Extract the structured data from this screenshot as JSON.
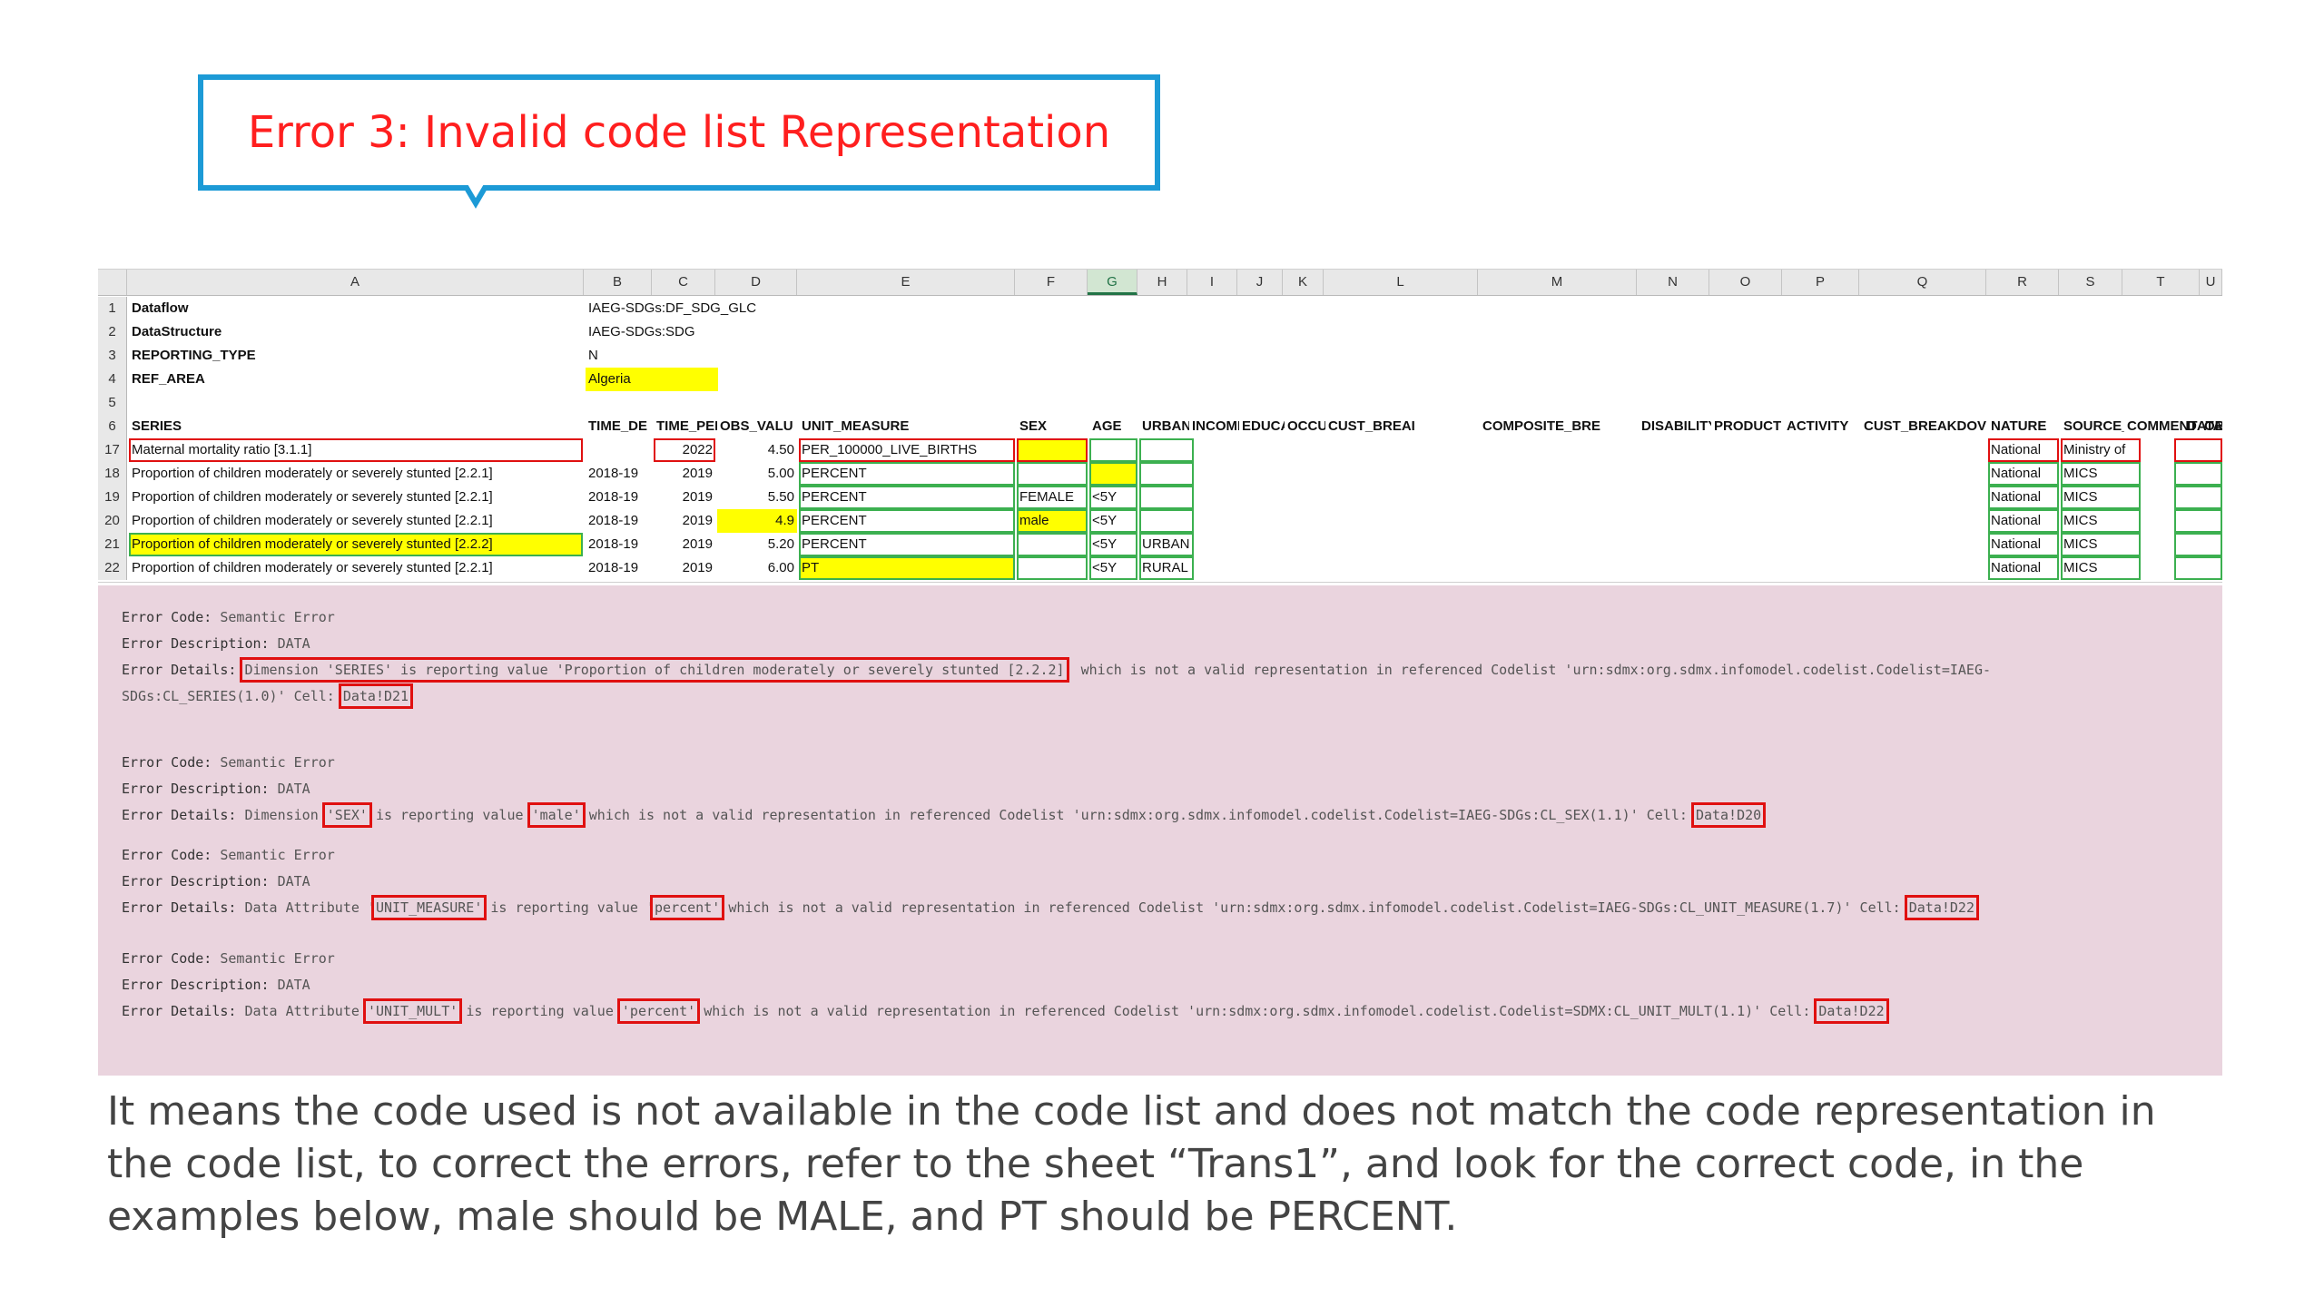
{
  "callout": {
    "title": "Error 3: Invalid code list Representation"
  },
  "sheet": {
    "columns": [
      "A",
      "B",
      "C",
      "D",
      "E",
      "F",
      "G",
      "H",
      "I",
      "J",
      "K",
      "L",
      "M",
      "N",
      "O",
      "P",
      "Q",
      "R",
      "S",
      "T",
      "U"
    ],
    "row_numbers": [
      "1",
      "2",
      "3",
      "4",
      "5",
      "6",
      "17",
      "18",
      "19",
      "20",
      "21",
      "22"
    ],
    "meta": [
      {
        "key": "Dataflow",
        "value": "IAEG-SDGs:DF_SDG_GLC"
      },
      {
        "key": "DataStructure",
        "value": "IAEG-SDGs:SDG"
      },
      {
        "key": "REPORTING_TYPE",
        "value": "N"
      },
      {
        "key": "REF_AREA",
        "value": "Algeria"
      }
    ],
    "headers": [
      "SERIES",
      "TIME_DE",
      "TIME_PEI",
      "OBS_VALU",
      "UNIT_MEASURE",
      "SEX",
      "AGE",
      "URBANI",
      "INCOME",
      "EDUCA",
      "OCCUP",
      "CUST_BREAI",
      "COMPOSITE_BRE",
      "DISABILITY",
      "PRODUCT",
      "ACTIVITY",
      "CUST_BREAKDOV",
      "NATURE",
      "SOURCE_DI",
      "COMMENT",
      "OBS_STA",
      "DATA_"
    ],
    "rows": [
      {
        "series": "Maternal mortality ratio [3.1.1]",
        "time_detail": "",
        "time_period": "2022",
        "obs": "4.50",
        "unit": "PER_100000_LIVE_BIRTHS",
        "sex": "",
        "age": "",
        "urban": "",
        "nature": "National",
        "source": "Ministry of"
      },
      {
        "series": "Proportion of children moderately or severely stunted [2.2.1]",
        "time_detail": "2018-19",
        "time_period": "2019",
        "obs": "5.00",
        "unit": "PERCENT",
        "sex": "",
        "age": "",
        "urban": "",
        "nature": "National",
        "source": "MICS"
      },
      {
        "series": "Proportion of children moderately or severely stunted [2.2.1]",
        "time_detail": "2018-19",
        "time_period": "2019",
        "obs": "5.50",
        "unit": "PERCENT",
        "sex": "FEMALE",
        "age": "<5Y",
        "urban": "",
        "nature": "National",
        "source": "MICS"
      },
      {
        "series": "Proportion of children moderately or severely stunted [2.2.1]",
        "time_detail": "2018-19",
        "time_period": "2019",
        "obs": "4.9",
        "unit": "PERCENT",
        "sex": "male",
        "age": "<5Y",
        "urban": "",
        "nature": "National",
        "source": "MICS"
      },
      {
        "series": "Proportion of children moderately or severely stunted [2.2.2]",
        "time_detail": "2018-19",
        "time_period": "2019",
        "obs": "5.20",
        "unit": "PERCENT",
        "sex": "",
        "age": "<5Y",
        "urban": "URBAN",
        "nature": "National",
        "source": "MICS"
      },
      {
        "series": "Proportion of children moderately or severely stunted [2.2.1]",
        "time_detail": "2018-19",
        "time_period": "2019",
        "obs": "6.00",
        "unit": "PT",
        "sex": "",
        "age": "<5Y",
        "urban": "RURAL",
        "nature": "National",
        "source": "MICS"
      }
    ]
  },
  "errors": {
    "label_code": "Error Code:",
    "label_desc": "Error Description:",
    "label_details": "Error Details:",
    "code_value": "Semantic Error",
    "desc_value": "DATA",
    "e1": {
      "boxed": "Dimension 'SERIES' is reporting value 'Proportion of children moderately or severely stunted [2.2.2]",
      "rest": "' which is not a valid representation in referenced Codelist 'urn:sdmx:org.sdmx.infomodel.codelist.Codelist=IAEG-",
      "line2": "SDGs:CL_SERIES(1.0)' Cell:",
      "cell": "Data!D21"
    },
    "e2": {
      "pre": "Dimension",
      "dim": "'SEX'",
      "mid": "is reporting value",
      "val": "'male'",
      "rest": "which is not a valid representation in referenced Codelist 'urn:sdmx:org.sdmx.infomodel.codelist.Codelist=IAEG-SDGs:CL_SEX(1.1)' Cell:",
      "cell": "Data!D20"
    },
    "e3": {
      "pre": "Data Attribute '",
      "attr": "UNIT_MEASURE'",
      "mid": "is reporting value '",
      "val": "percent'",
      "rest": "which is not a valid representation in referenced Codelist 'urn:sdmx:org.sdmx.infomodel.codelist.Codelist=IAEG-SDGs:CL_UNIT_MEASURE(1.7)' Cell:",
      "cell": "Data!D22"
    },
    "e4": {
      "pre": "Data Attribute",
      "attr": "'UNIT_MULT'",
      "mid": "is reporting value",
      "val": "'percent'",
      "rest": "which is not a valid representation in referenced Codelist 'urn:sdmx:org.sdmx.infomodel.codelist.Codelist=SDMX:CL_UNIT_MULT(1.1)' Cell:",
      "cell": "Data!D22"
    }
  },
  "footer": {
    "text": "It means the code used is not available in the code list and does not match the code representation in the code list, to correct the errors, refer to the sheet “Trans1”, and look for the correct code, in the examples below, male should be MALE, and PT should be PERCENT."
  }
}
